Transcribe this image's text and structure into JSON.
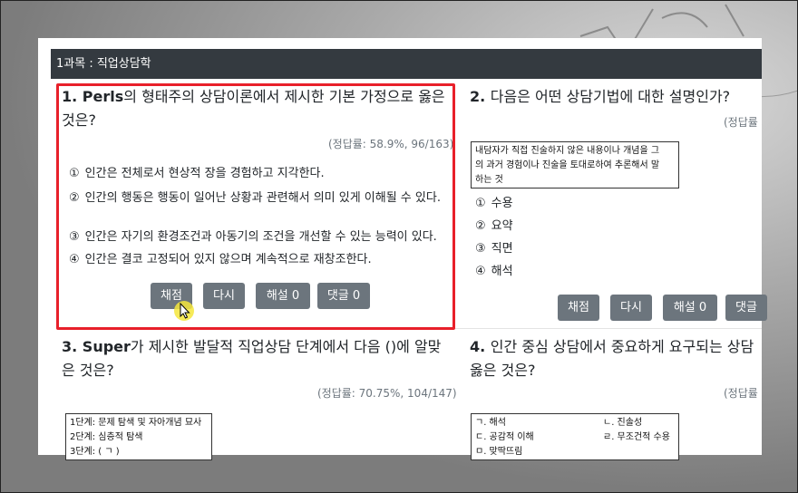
{
  "subject": "1과목 : 직업상담학",
  "questions": [
    {
      "number": "1.",
      "lead": "Perls",
      "title": "의 형태주의 상담이론에서 제시한 기본 가정으로 옳은",
      "title2": "것은?",
      "rate": "(정답률: 58.9%, 96/163)",
      "options": [
        {
          "num": "①",
          "text": "인간은 전체로서 현상적 장을 경험하고 지각한다."
        },
        {
          "num": "②",
          "text": "인간의 행동은 행동이 일어난 상황과 관련해서 의미 있게 이해될 수 있다."
        },
        {
          "num": "③",
          "text": "인간은 자기의 환경조건과 아동기의 조건을 개선할 수 있는 능력이 있다."
        },
        {
          "num": "④",
          "text": "인간은 결코 고정되어 있지 않으며 계속적으로 재창조한다."
        }
      ],
      "buttons": [
        "채점",
        "다시",
        "해설 0",
        "댓글 0"
      ]
    },
    {
      "number": "2.",
      "title": "다음은 어떤 상담기법에 대한 설명인가?",
      "rate": "(정답률",
      "box": [
        "내담자가 직접 진술하지 않은 내용이나 개념을 그",
        "의 과거 경험이나 진술을 토대로하여 추론해서 말",
        "하는 것"
      ],
      "options": [
        {
          "num": "①",
          "text": "수용"
        },
        {
          "num": "②",
          "text": "요약"
        },
        {
          "num": "③",
          "text": "직면"
        },
        {
          "num": "④",
          "text": "해석"
        }
      ],
      "buttons": [
        "채점",
        "다시",
        "해설 0",
        "댓글"
      ]
    },
    {
      "number": "3.",
      "lead": "Super",
      "title": "가 제시한 발달적 직업상담 단계에서 다음 ()에 알맞",
      "title2": "은 것은?",
      "rate": "(정답률: 70.75%, 104/147)",
      "box": [
        "1단계: 문제 탐색 및 자아개념 묘사",
        "2단계: 심층적 탐색",
        "3단계: ( ㄱ )"
      ]
    },
    {
      "number": "4.",
      "title": "인간 중심 상담에서 중요하게 요구되는 상담",
      "title2": "옳은 것은?",
      "rate": "(정답률",
      "box_left": [
        "ㄱ. 해석",
        "ㄷ. 공감적 이해",
        "ㅁ. 맞딱뜨림"
      ],
      "box_right": [
        "ㄴ. 진솔성",
        "ㄹ. 무조건적 수용"
      ]
    }
  ]
}
